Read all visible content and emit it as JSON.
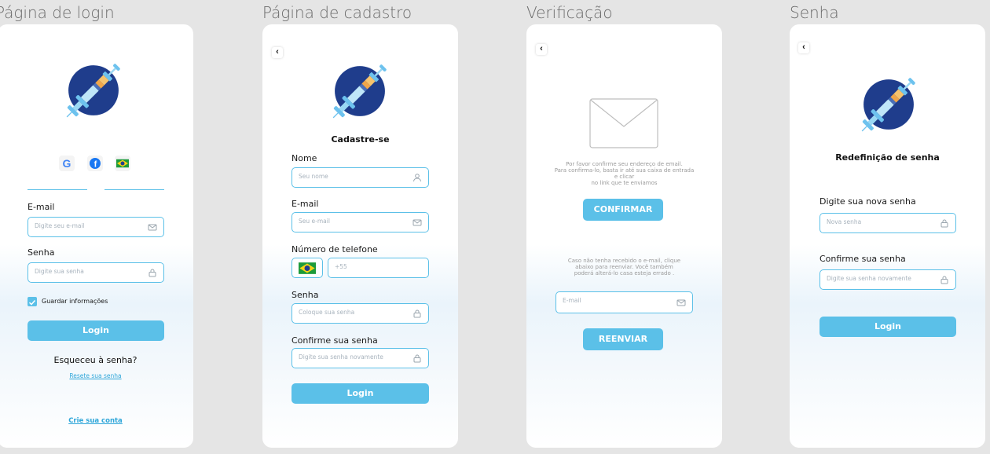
{
  "frames": {
    "login": {
      "title": "Página de login",
      "social": [
        "google-logo",
        "facebook-logo",
        "brazil-flag"
      ],
      "email_label": "E-mail",
      "email_placeholder": "Digite seu e-mail",
      "password_label": "Senha",
      "password_placeholder": "Digite sua senha",
      "remember_label": "Guardar informações",
      "remember_checked": true,
      "login_button": "Login",
      "forgot_text": "Esqueceu à senha?",
      "reset_link": "Resete sua senha",
      "create_link": "Crie sua conta"
    },
    "register": {
      "title": "Página de cadastro",
      "heading": "Cadastre-se",
      "name_label": "Nome",
      "name_placeholder": "Seu nome",
      "email_label": "E-mail",
      "email_placeholder": "Seu e-mail",
      "phone_label": "Número de telefone",
      "phone_placeholder": "+55",
      "password_label": "Senha",
      "password_placeholder": "Coloque sua senha",
      "confirm_label": "Confirme sua senha",
      "confirm_placeholder": "Digite sua senha novamente",
      "login_button": "Login"
    },
    "verify": {
      "title": "Verificação",
      "message_line1": "Por favor confirme seu endereço de email.",
      "message_line2": "Para confirma-lo, basta ir até sua caixa de entrada",
      "message_line3": "e clicar",
      "message_line4": "no link que te enviamos",
      "confirm_button": "CONFIRMAR",
      "resend_line1": "Caso não tenha recebido o e-mail, clique",
      "resend_line2": "abaixo para reenviar. Você também",
      "resend_line3": "poderá alterá-lo casa esteja errado .",
      "email_placeholder": "E-mail",
      "resend_button": "REENVIAR"
    },
    "reset": {
      "title": "Senha",
      "heading": "Redefinição de senha",
      "new_label": "Digite sua nova senha",
      "new_placeholder": "Nova senha",
      "confirm_label": "Confirme sua senha",
      "confirm_placeholder": "Digite sua senha novamente",
      "login_button": "Login"
    }
  },
  "colors": {
    "accent": "#5bc0e8",
    "logo_circle": "#1f3d8c",
    "background": "#e5e5e5"
  }
}
